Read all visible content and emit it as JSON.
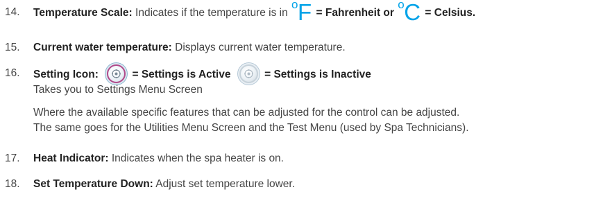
{
  "items": [
    {
      "number": "14.",
      "term": "Temperature Scale:",
      "text_before": "Indicates if the temperature is in",
      "f_symbol": "F",
      "f_label": "= Fahrenheit or",
      "c_symbol": "C",
      "c_label": "= Celsius."
    },
    {
      "number": "15.",
      "term": "Current water temperature:",
      "text": "Displays current water temperature."
    },
    {
      "number": "16.",
      "term": "Setting Icon:",
      "active_label": "= Settings is Active",
      "inactive_label": "= Settings is Inactive",
      "line2": "Takes you to Settings Menu Screen",
      "para_line1": "Where the available specific features that can be adjusted for the control can be adjusted.",
      "para_line2": "The same goes for the Utilities Menu Screen and the Test Menu (used by Spa Technicians)."
    },
    {
      "number": "17.",
      "term": "Heat Indicator:",
      "text": "Indicates when the spa heater is on."
    },
    {
      "number": "18.",
      "term": "Set Temperature Down:",
      "text": "Adjust set temperature lower."
    }
  ],
  "icons": {
    "degree": "degree-circle",
    "settings_active": "gear-icon-active",
    "settings_inactive": "gear-icon-inactive"
  },
  "colors": {
    "symbol": "#00a3e8",
    "active_ring": "#b14a8b"
  }
}
